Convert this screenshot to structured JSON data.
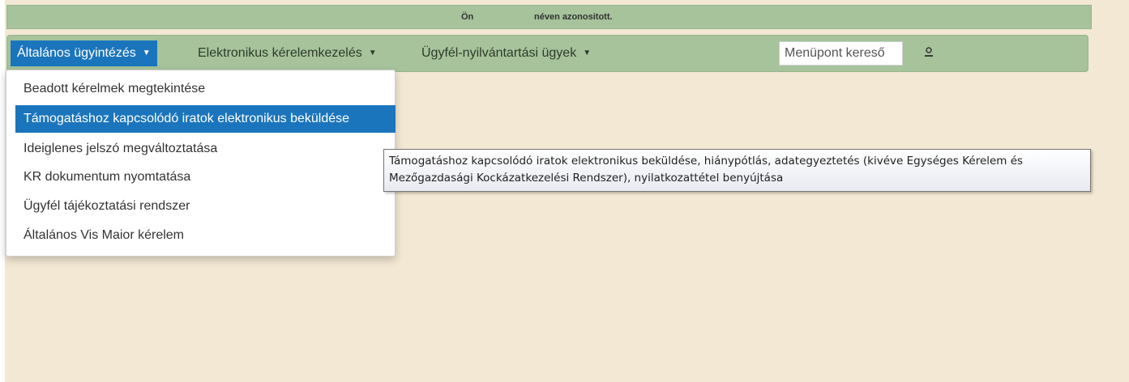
{
  "identity_bar": {
    "prefix": "Ön",
    "suffix": "néven azonositott."
  },
  "nav": {
    "items": [
      {
        "label": "Általános ügyintézés",
        "active": true
      },
      {
        "label": "Elektronikus kérelemkezelés",
        "active": false
      },
      {
        "label": "Ügyfél-nyilvántartási ügyek",
        "active": false
      }
    ],
    "search_placeholder": "Menüpont kereső",
    "user_icon": "user-icon",
    "caret_icon": "caret-down-icon"
  },
  "dropdown": {
    "items": [
      {
        "label": "Beadott kérelmek megtekintése",
        "highlighted": false
      },
      {
        "label": "Támogatáshoz kapcsolódó iratok elektronikus beküldése",
        "highlighted": true
      },
      {
        "label": "Ideiglenes jelszó megváltoztatása",
        "highlighted": false
      },
      {
        "label": "KR dokumentum nyomtatása",
        "highlighted": false
      },
      {
        "label": "Ügyfél tájékoztatási rendszer",
        "highlighted": false
      },
      {
        "label": "Általános Vis Maior kérelem",
        "highlighted": false
      }
    ]
  },
  "tooltip": {
    "line1": "Támogatáshoz kapcsolódó iratok elektronikus beküldése, hiánypótlás, adategyeztetés (kivéve Egységes Kérelem és",
    "line2": "Mezőgazdasági Kockázatkezelési Rendszer), nyilatkozattétel benyújtása"
  },
  "colors": {
    "background": "#f3e8d3",
    "bar_green": "#a6c39b",
    "accent_blue": "#1b75bc"
  }
}
